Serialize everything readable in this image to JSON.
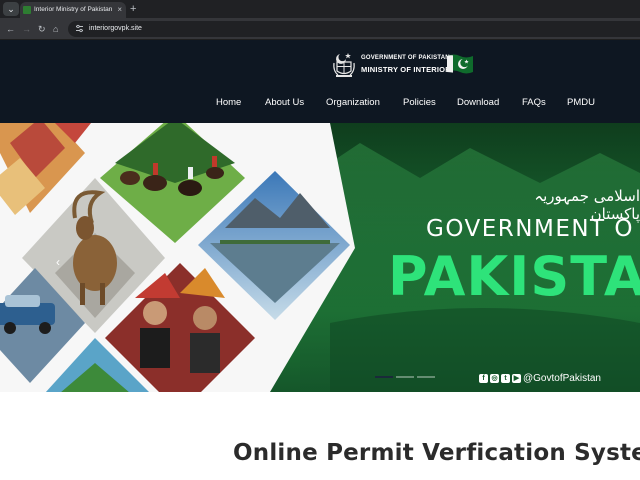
{
  "browser": {
    "tab_title": "Interior Ministry of Pakistan",
    "tab_close": "×",
    "new_tab": "+",
    "url": "interiorgovpk.site",
    "menu_icon": "chevron-down-icon",
    "colors": {
      "chrome_dark": "#202124",
      "chrome_mid": "#35363a"
    }
  },
  "header": {
    "government_label": "GOVERNMENT OF PAKISTAN",
    "ministry_label": "MINISTRY OF INTERIOR",
    "background": "#0e1722"
  },
  "nav": {
    "items": [
      {
        "label": "Home"
      },
      {
        "label": "About Us"
      },
      {
        "label": "Organization"
      },
      {
        "label": "Policies"
      },
      {
        "label": "Download"
      },
      {
        "label": "FAQs"
      },
      {
        "label": "PMDU"
      }
    ]
  },
  "hero": {
    "urdu_text": "اسلامی جمہوریہ پاکستان",
    "title_line1": "GOVERNMENT O",
    "title_line2": "PAKISTA",
    "social_handle": "@GovtofPakistan",
    "slide_count": 3,
    "active_slide": 1,
    "colors": {
      "green": "#1d7a36",
      "accent_green": "#2ee37a"
    }
  },
  "main": {
    "page_title": "Online Permit Verfication System"
  }
}
